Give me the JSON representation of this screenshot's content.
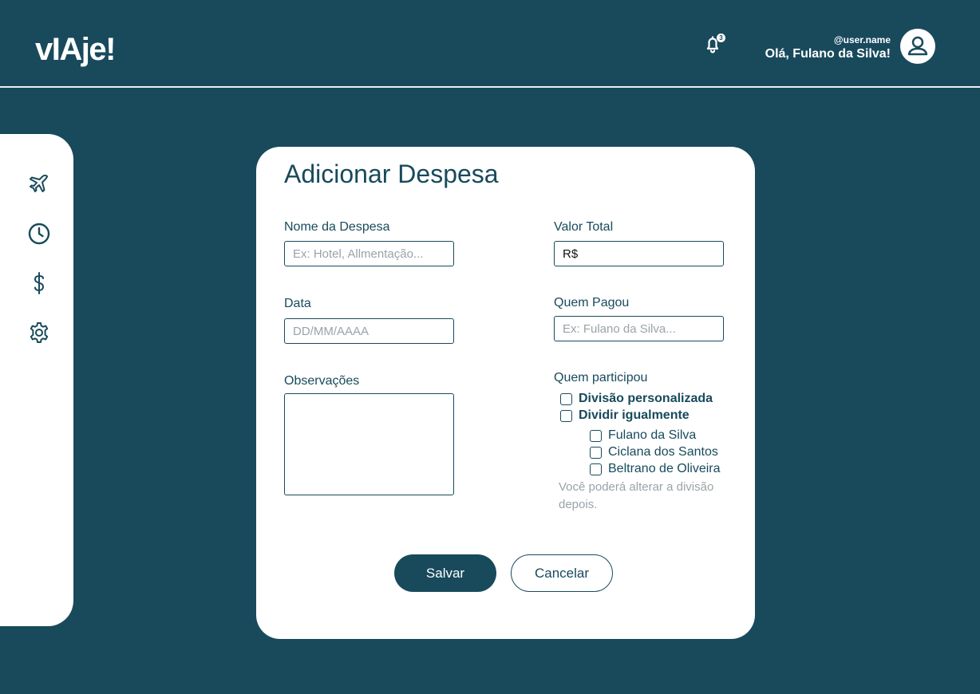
{
  "app": {
    "logo": "vIAje!"
  },
  "header": {
    "notification_count": "3",
    "user_handle": "@user.name",
    "greeting": "Olá, Fulano da Silva!"
  },
  "sidebar": {
    "items": [
      {
        "icon": "airplane-icon"
      },
      {
        "icon": "clock-icon"
      },
      {
        "icon": "dollar-icon"
      },
      {
        "icon": "gear-icon"
      }
    ]
  },
  "form": {
    "title": "Adicionar Despesa",
    "name_label": "Nome da Despesa",
    "name_placeholder": "Ex: Hotel, Allmentação...",
    "total_label": "Valor Total",
    "total_value": "R$",
    "date_label": "Data",
    "date_placeholder": "DD/MM/AAAA",
    "payer_label": "Quem Pagou",
    "payer_placeholder": "Ex: Fulano da Silva...",
    "notes_label": "Observações",
    "participants_label": "Quem participou",
    "split_options": [
      "Divisão personalizada",
      "Dividir igualmente"
    ],
    "participants": [
      "Fulano da Silva",
      "Ciclana dos Santos",
      "Beltrano de Oliveira"
    ],
    "hint": "Você poderá alterar a divisão depois.",
    "save_label": "Salvar",
    "cancel_label": "Cancelar"
  }
}
